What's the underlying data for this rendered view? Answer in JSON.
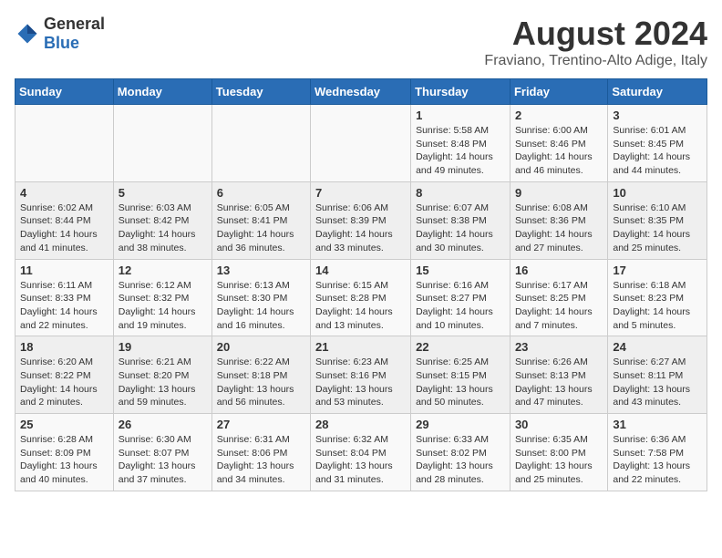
{
  "header": {
    "logo_general": "General",
    "logo_blue": "Blue",
    "title": "August 2024",
    "location": "Fraviano, Trentino-Alto Adige, Italy"
  },
  "columns": [
    "Sunday",
    "Monday",
    "Tuesday",
    "Wednesday",
    "Thursday",
    "Friday",
    "Saturday"
  ],
  "weeks": [
    [
      {
        "day": "",
        "info": ""
      },
      {
        "day": "",
        "info": ""
      },
      {
        "day": "",
        "info": ""
      },
      {
        "day": "",
        "info": ""
      },
      {
        "day": "1",
        "info": "Sunrise: 5:58 AM\nSunset: 8:48 PM\nDaylight: 14 hours and 49 minutes."
      },
      {
        "day": "2",
        "info": "Sunrise: 6:00 AM\nSunset: 8:46 PM\nDaylight: 14 hours and 46 minutes."
      },
      {
        "day": "3",
        "info": "Sunrise: 6:01 AM\nSunset: 8:45 PM\nDaylight: 14 hours and 44 minutes."
      }
    ],
    [
      {
        "day": "4",
        "info": "Sunrise: 6:02 AM\nSunset: 8:44 PM\nDaylight: 14 hours and 41 minutes."
      },
      {
        "day": "5",
        "info": "Sunrise: 6:03 AM\nSunset: 8:42 PM\nDaylight: 14 hours and 38 minutes."
      },
      {
        "day": "6",
        "info": "Sunrise: 6:05 AM\nSunset: 8:41 PM\nDaylight: 14 hours and 36 minutes."
      },
      {
        "day": "7",
        "info": "Sunrise: 6:06 AM\nSunset: 8:39 PM\nDaylight: 14 hours and 33 minutes."
      },
      {
        "day": "8",
        "info": "Sunrise: 6:07 AM\nSunset: 8:38 PM\nDaylight: 14 hours and 30 minutes."
      },
      {
        "day": "9",
        "info": "Sunrise: 6:08 AM\nSunset: 8:36 PM\nDaylight: 14 hours and 27 minutes."
      },
      {
        "day": "10",
        "info": "Sunrise: 6:10 AM\nSunset: 8:35 PM\nDaylight: 14 hours and 25 minutes."
      }
    ],
    [
      {
        "day": "11",
        "info": "Sunrise: 6:11 AM\nSunset: 8:33 PM\nDaylight: 14 hours and 22 minutes."
      },
      {
        "day": "12",
        "info": "Sunrise: 6:12 AM\nSunset: 8:32 PM\nDaylight: 14 hours and 19 minutes."
      },
      {
        "day": "13",
        "info": "Sunrise: 6:13 AM\nSunset: 8:30 PM\nDaylight: 14 hours and 16 minutes."
      },
      {
        "day": "14",
        "info": "Sunrise: 6:15 AM\nSunset: 8:28 PM\nDaylight: 14 hours and 13 minutes."
      },
      {
        "day": "15",
        "info": "Sunrise: 6:16 AM\nSunset: 8:27 PM\nDaylight: 14 hours and 10 minutes."
      },
      {
        "day": "16",
        "info": "Sunrise: 6:17 AM\nSunset: 8:25 PM\nDaylight: 14 hours and 7 minutes."
      },
      {
        "day": "17",
        "info": "Sunrise: 6:18 AM\nSunset: 8:23 PM\nDaylight: 14 hours and 5 minutes."
      }
    ],
    [
      {
        "day": "18",
        "info": "Sunrise: 6:20 AM\nSunset: 8:22 PM\nDaylight: 14 hours and 2 minutes."
      },
      {
        "day": "19",
        "info": "Sunrise: 6:21 AM\nSunset: 8:20 PM\nDaylight: 13 hours and 59 minutes."
      },
      {
        "day": "20",
        "info": "Sunrise: 6:22 AM\nSunset: 8:18 PM\nDaylight: 13 hours and 56 minutes."
      },
      {
        "day": "21",
        "info": "Sunrise: 6:23 AM\nSunset: 8:16 PM\nDaylight: 13 hours and 53 minutes."
      },
      {
        "day": "22",
        "info": "Sunrise: 6:25 AM\nSunset: 8:15 PM\nDaylight: 13 hours and 50 minutes."
      },
      {
        "day": "23",
        "info": "Sunrise: 6:26 AM\nSunset: 8:13 PM\nDaylight: 13 hours and 47 minutes."
      },
      {
        "day": "24",
        "info": "Sunrise: 6:27 AM\nSunset: 8:11 PM\nDaylight: 13 hours and 43 minutes."
      }
    ],
    [
      {
        "day": "25",
        "info": "Sunrise: 6:28 AM\nSunset: 8:09 PM\nDaylight: 13 hours and 40 minutes."
      },
      {
        "day": "26",
        "info": "Sunrise: 6:30 AM\nSunset: 8:07 PM\nDaylight: 13 hours and 37 minutes."
      },
      {
        "day": "27",
        "info": "Sunrise: 6:31 AM\nSunset: 8:06 PM\nDaylight: 13 hours and 34 minutes."
      },
      {
        "day": "28",
        "info": "Sunrise: 6:32 AM\nSunset: 8:04 PM\nDaylight: 13 hours and 31 minutes."
      },
      {
        "day": "29",
        "info": "Sunrise: 6:33 AM\nSunset: 8:02 PM\nDaylight: 13 hours and 28 minutes."
      },
      {
        "day": "30",
        "info": "Sunrise: 6:35 AM\nSunset: 8:00 PM\nDaylight: 13 hours and 25 minutes."
      },
      {
        "day": "31",
        "info": "Sunrise: 6:36 AM\nSunset: 7:58 PM\nDaylight: 13 hours and 22 minutes."
      }
    ]
  ]
}
